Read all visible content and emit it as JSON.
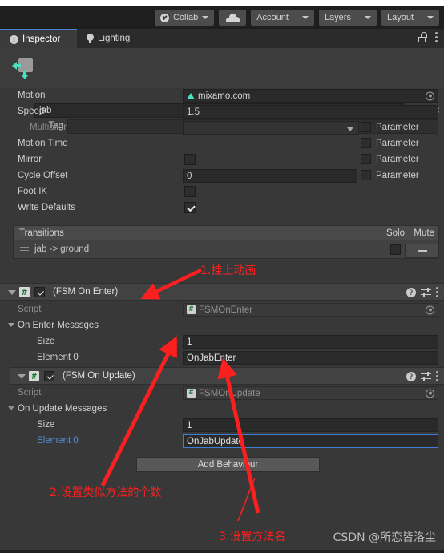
{
  "toolbar": {
    "collab": "Collab",
    "cloud_icon": "cloud-icon",
    "account": "Account",
    "layers": "Layers",
    "layout": "Layout"
  },
  "tabs": {
    "inspector": "Inspector",
    "lighting": "Lighting",
    "lock_icon": "lock-open-icon",
    "menu_icon": "kebab-menu-icon"
  },
  "header": {
    "name_value": "jab",
    "tag_label": "Tag",
    "tag_value": "",
    "help_icon": "?",
    "preset_icon": "preset-icon",
    "gear_icon": "gear-icon"
  },
  "properties": [
    {
      "label": "Motion",
      "value": "mixamo.com",
      "type": "object"
    },
    {
      "label": "Speed",
      "value": "1.5",
      "type": "text"
    },
    {
      "label": "Multiplier",
      "value": "",
      "type": "dropdown",
      "param": "Parameter"
    },
    {
      "label": "Motion Time",
      "value": "",
      "type": "none",
      "param": "Parameter"
    },
    {
      "label": "Mirror",
      "value": "",
      "type": "checkbox",
      "param": "Parameter"
    },
    {
      "label": "Cycle Offset",
      "value": "0",
      "type": "smalltext",
      "param": "Parameter"
    },
    {
      "label": "Foot IK",
      "value": "",
      "type": "checkbox"
    },
    {
      "label": "Write Defaults",
      "value": "",
      "type": "checkbox_checked"
    }
  ],
  "transitions": {
    "title": "Transitions",
    "solo": "Solo",
    "mute": "Mute",
    "rows": [
      {
        "label": "jab -> ground",
        "solo": false,
        "mute": false
      }
    ],
    "minus_label": "−"
  },
  "components": [
    {
      "title": "(FSM On Enter)",
      "script_label": "Script",
      "script_value": "FSMOnEnter",
      "array_label": "On Enter Messsges",
      "size_label": "Size",
      "size_value": "1",
      "element_label": "Element 0",
      "element_value": "OnJabEnter",
      "focused": false
    },
    {
      "title": "(FSM On Update)",
      "script_label": "Script",
      "script_value": "FSMOnUpdate",
      "array_label": "On Update Messages",
      "size_label": "Size",
      "size_value": "1",
      "element_label": "Element 0",
      "element_value": "OnJabUpdate",
      "focused": true
    }
  ],
  "add_behaviour": "Add Behaviour",
  "annotations": [
    {
      "text": "1.挂上动画"
    },
    {
      "text": "2.设置类似方法的个数"
    },
    {
      "text": "3.设置方法名"
    }
  ],
  "watermark": "CSDN @所恋皆洛尘",
  "colors": {
    "accent_blue": "#4b7fd0",
    "annotation_red": "#ff1f1f",
    "teal": "#49e0c0",
    "script_green": "#1f7a33"
  }
}
